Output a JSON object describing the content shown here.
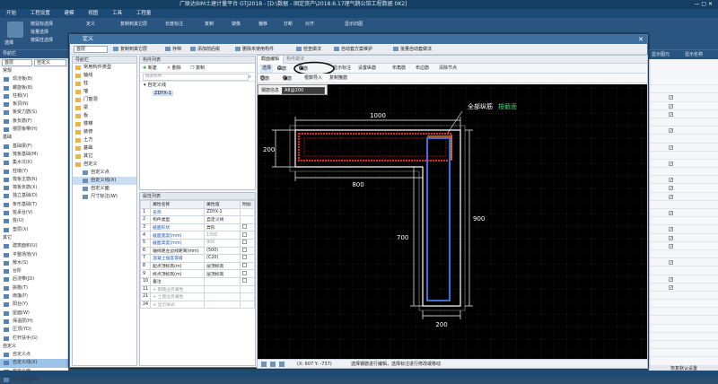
{
  "app": {
    "title": "广联达BIM土建计量平台 GTJ2018 - [D:\\数据 - 固定资产\\2018.6.17理气鹅公馆工程数据 0K2]",
    "menu": [
      "开始",
      "工程设置",
      "建模",
      "视图",
      "工具",
      "工程量"
    ],
    "ribbon": {
      "select_label": "选择",
      "items": [
        "按鼠标选择",
        "批量选择",
        "按属性选择",
        "定义",
        "复制到其它层",
        "长度标注",
        "复制",
        "镜像",
        "偏移",
        "打断",
        "对齐",
        "显示旧图"
      ]
    },
    "left_panel": {
      "header": "导航栏",
      "combo_left": "首层",
      "combo_right": "自定义",
      "items": [
        {
          "label": "常规",
          "group": true
        },
        {
          "label": "现浇板(B)"
        },
        {
          "label": "螺旋板(B)"
        },
        {
          "label": "柱帽(V)"
        },
        {
          "label": "板洞(N)"
        },
        {
          "label": "板受力筋(S)"
        },
        {
          "label": "板负筋(F)"
        },
        {
          "label": "楼层板带(H)"
        },
        {
          "label": "基础",
          "group": true
        },
        {
          "label": "基础梁(F)"
        },
        {
          "label": "筏板基础(M)"
        },
        {
          "label": "集水坑(K)"
        },
        {
          "label": "柱墩(Y)"
        },
        {
          "label": "筏板主筋(R)"
        },
        {
          "label": "筏板负筋(X)"
        },
        {
          "label": "独立基础(D)"
        },
        {
          "label": "条形基础(T)"
        },
        {
          "label": "桩承台(V)"
        },
        {
          "label": "桩(U)"
        },
        {
          "label": "垫层(X)"
        },
        {
          "label": "其它",
          "group": true
        },
        {
          "label": "建筑面积(U)"
        },
        {
          "label": "平整场地(V)"
        },
        {
          "label": "散水(S)"
        },
        {
          "label": "台阶"
        },
        {
          "label": "后浇带(JD)"
        },
        {
          "label": "挑檐(T)"
        },
        {
          "label": "雨篷(P)"
        },
        {
          "label": "阳台(Y)"
        },
        {
          "label": "屋面(W)"
        },
        {
          "label": "保温层(H)"
        },
        {
          "label": "压顶(YD)"
        },
        {
          "label": "栏杆扶手(G)"
        },
        {
          "label": "自定义",
          "group": true
        },
        {
          "label": "自定义点"
        },
        {
          "label": "自定义线(X)",
          "selected": true
        },
        {
          "label": "自定义面"
        },
        {
          "label": "尺寸标注(W)"
        }
      ]
    },
    "right_panel": {
      "header": "显示图元",
      "header2": "显示名称",
      "footer": "恢复默认设置"
    },
    "statusbar": ""
  },
  "dialog": {
    "title": "定义",
    "close_icon": "close-icon",
    "floor_combo": "首层",
    "toolbar": [
      "复制到其它层",
      "存档",
      "添加前后缀",
      "删除未使用构件",
      "检查做法",
      "自动套方案维护",
      "批量自动套做法"
    ],
    "nav": {
      "header": "导航栏",
      "items": [
        {
          "label": "常用构件类型",
          "level": 0
        },
        {
          "label": "轴线",
          "level": 0
        },
        {
          "label": "柱",
          "level": 0
        },
        {
          "label": "墙",
          "level": 0
        },
        {
          "label": "门窗洞",
          "level": 0
        },
        {
          "label": "梁",
          "level": 0
        },
        {
          "label": "板",
          "level": 0
        },
        {
          "label": "楼梯",
          "level": 0
        },
        {
          "label": "装修",
          "level": 0
        },
        {
          "label": "土方",
          "level": 0
        },
        {
          "label": "基础",
          "level": 0
        },
        {
          "label": "其它",
          "level": 0
        },
        {
          "label": "自定义",
          "level": 0
        },
        {
          "label": "自定义点",
          "level": 1
        },
        {
          "label": "自定义线(X)",
          "level": 1,
          "selected": true
        },
        {
          "label": "自定义面",
          "level": 1
        },
        {
          "label": "尺寸标注(W)",
          "level": 1
        }
      ]
    },
    "components": {
      "header": "构件列表",
      "new_label": "新建",
      "delete_label": "删除",
      "copy_label": "复制",
      "search_placeholder": "搜索构件...",
      "tree_root": "自定义线",
      "tree_child": "ZDYX-1"
    },
    "properties": {
      "header": "属性列表",
      "columns": [
        "属性名称",
        "属性值",
        "附加"
      ],
      "rows": [
        {
          "n": "1",
          "name": "名称",
          "value": "ZDYX-1",
          "blue": true,
          "cb": false
        },
        {
          "n": "2",
          "name": "构件类型",
          "value": "自定义线",
          "blue": false,
          "cb": false
        },
        {
          "n": "3",
          "name": "截面形状",
          "value": "异形",
          "blue": true,
          "cb": true
        },
        {
          "n": "4",
          "name": "截面宽度(mm)",
          "value": "1000",
          "blue": true,
          "cb": true,
          "gray": true
        },
        {
          "n": "5",
          "name": "截面高度(mm)",
          "value": "900",
          "blue": true,
          "cb": true,
          "gray": true
        },
        {
          "n": "6",
          "name": "轴线距左边线距离(mm)",
          "value": "(500)",
          "blue": false,
          "cb": true
        },
        {
          "n": "7",
          "name": "混凝土强度等级",
          "value": "(C20)",
          "blue": true,
          "cb": true
        },
        {
          "n": "8",
          "name": "起点顶标高(m)",
          "value": "层顶标高",
          "blue": false,
          "cb": true
        },
        {
          "n": "9",
          "name": "终点顶标高(m)",
          "value": "层顶标高",
          "blue": false,
          "cb": true
        },
        {
          "n": "10",
          "name": "备注",
          "value": "",
          "blue": false,
          "cb": true
        },
        {
          "n": "11",
          "name": "+ 钢筋业务属性",
          "value": "",
          "blue": false,
          "cb": false,
          "gray": true
        },
        {
          "n": "21",
          "name": "+ 土建业务属性",
          "value": "",
          "blue": false,
          "cb": false,
          "gray": true
        },
        {
          "n": "24",
          "name": "+ 显示样式",
          "value": "",
          "blue": false,
          "cb": false,
          "gray": true
        }
      ]
    },
    "editor": {
      "tabs": [
        "截面编辑",
        "构件做法"
      ],
      "toolbar1": [
        "选择",
        "纵筋",
        "横筋",
        "显示标注",
        "设置纵筋",
        "布角筋",
        "布边筋",
        "清除节点"
      ],
      "toolbar2": [
        "直筋",
        "箍筋",
        "根数导入",
        "复制箍筋"
      ],
      "radio_selected": "横筋",
      "popup_label": "钢筋信息",
      "popup_value": "A8@200",
      "annotation": "全部纵筋",
      "annotation_value": "按截面",
      "dims": [
        "1000",
        "200",
        "800",
        "900",
        "700",
        "200"
      ],
      "coords": "(X: 607 Y: -737)",
      "hint": "选择钢筋进行编辑，选择标注进行修改或移动"
    }
  },
  "colors": {
    "accent": "#2a5580",
    "canvas_bg": "#000000",
    "outline": "#ffffff",
    "rebar_red": "#d42a2a",
    "rebar_blue": "#3a6fe0",
    "annotation_green": "#36d36b",
    "dim_text": "#ffffff"
  }
}
